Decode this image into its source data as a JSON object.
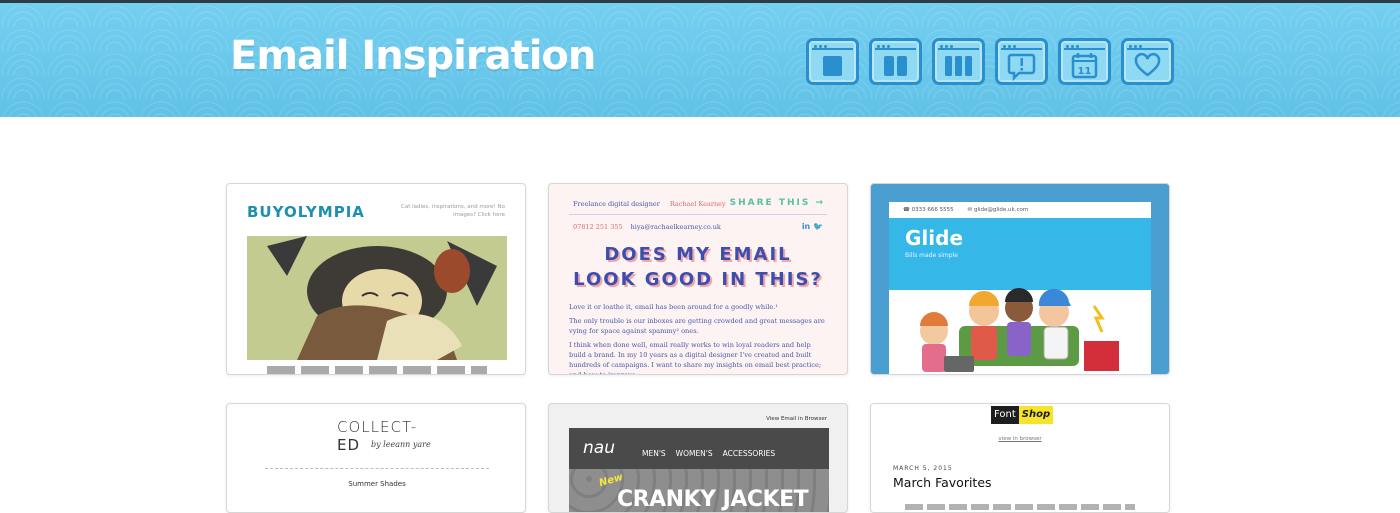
{
  "header": {
    "title": "Email Inspiration",
    "accent_color": "#6cc9ea",
    "layout_icons": [
      {
        "name": "layout-one-column-icon"
      },
      {
        "name": "layout-two-column-icon"
      },
      {
        "name": "layout-three-column-icon"
      },
      {
        "name": "alert-icon"
      },
      {
        "name": "calendar-icon",
        "day": "11"
      },
      {
        "name": "heart-icon"
      }
    ]
  },
  "cards": {
    "buyolympia": {
      "logo": "BUYOLYMPIA",
      "tagline": "Cat ladies, inspirations, and more! No images? Click here"
    },
    "rachael": {
      "role": "Freelance digital designer",
      "name": "Rachael Kearney",
      "share": "SHARE THIS →",
      "phone": "07812 251 355",
      "email": "hiya@rachaelkearney.co.uk",
      "social": "in  🐦",
      "headline_1": "DOES MY EMAIL",
      "headline_2": "LOOK GOOD IN THIS?",
      "para_1": "Love it or loathe it, email has been around for a goodly while.¹",
      "para_2": "The only trouble is our inboxes are getting crowded and great messages are vying for space against spammy² ones.",
      "para_3": "I think when done well, email really works to win loyal readers and help build a brand. In my 10 years as a digital designer I've created and built hundreds of campaigns. I want to share my insights on email best practice; and how to improve"
    },
    "glide": {
      "phone": "☎ 0333 666 5555",
      "email": "✉ glide@glide.uk.com",
      "logo": "Glide",
      "subtitle": "Bills made simple"
    },
    "collected": {
      "brand_1": "COLLECT-",
      "brand_2": "ED",
      "by": "by leeann yare",
      "subtitle": "Summer Shades"
    },
    "nau": {
      "view_browser": "View Email in Browser",
      "logo": "nau",
      "nav": [
        "MEN'S",
        "WOMEN'S",
        "ACCESSORIES"
      ],
      "new": "New",
      "promo": "CRANKY JACKET"
    },
    "fontshop": {
      "logo_a": "Font",
      "logo_b": "Shop",
      "view_browser": "view in browser",
      "date": "MARCH 5, 2015",
      "title": "March Favorites"
    }
  }
}
